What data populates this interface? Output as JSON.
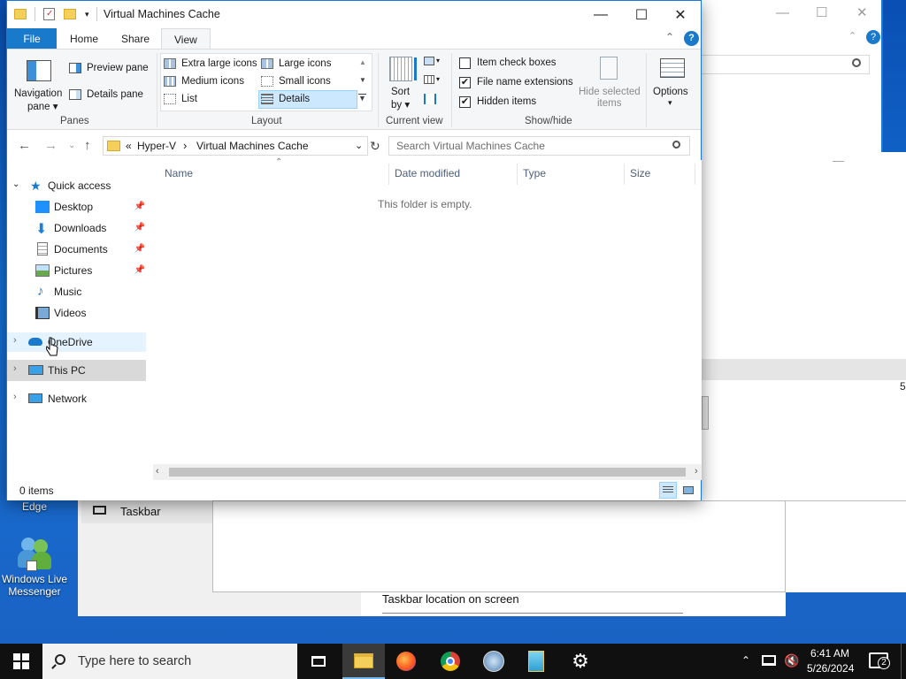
{
  "window": {
    "title": "Virtual Machines Cache",
    "minimize": "—",
    "maximize": "☐",
    "close": "✕"
  },
  "tabs": {
    "file": "File",
    "home": "Home",
    "share": "Share",
    "view": "View"
  },
  "ribbon": {
    "panes": {
      "navigation_pane_line1": "Navigation",
      "navigation_pane_line2": "pane ▾",
      "preview_pane": "Preview pane",
      "details_pane": "Details pane",
      "group_label": "Panes"
    },
    "layout": {
      "extra_large_icons": "Extra large icons",
      "large_icons": "Large icons",
      "medium_icons": "Medium icons",
      "small_icons": "Small icons",
      "list": "List",
      "details": "Details",
      "group_label": "Layout"
    },
    "current_view": {
      "sort_by_line1": "Sort",
      "sort_by_line2": "by ▾",
      "group_label": "Current view"
    },
    "show_hide": {
      "item_check_boxes": "Item check boxes",
      "item_check_boxes_checked": "",
      "file_name_extensions": "File name extensions",
      "file_name_extensions_checked": "✔",
      "hidden_items": "Hidden items",
      "hidden_items_checked": "✔",
      "hide_selected_line1": "Hide selected",
      "hide_selected_line2": "items",
      "group_label": "Show/hide"
    },
    "options_label": "Options",
    "options_arrow": "▾"
  },
  "address": {
    "breadcrumb_prefix": "«",
    "crumb1": "Hyper-V",
    "crumb_sep": "›",
    "crumb2": "Virtual Machines Cache",
    "search_placeholder": "Search Virtual Machines Cache"
  },
  "nav": {
    "quick_access": "Quick access",
    "desktop": "Desktop",
    "downloads": "Downloads",
    "documents": "Documents",
    "pictures": "Pictures",
    "music": "Music",
    "videos": "Videos",
    "onedrive": "OneDrive",
    "this_pc": "This PC",
    "network": "Network"
  },
  "columns": {
    "name": "Name",
    "date_modified": "Date modified",
    "type": "Type",
    "size": "Size"
  },
  "empty_message": "This folder is empty.",
  "status": {
    "item_count": "0 items"
  },
  "desktop_icons": {
    "edge": "Edge",
    "messenger_line1": "Windows Live",
    "messenger_line2": "Messenger"
  },
  "background": {
    "taskbar_item": "Taskbar",
    "taskbar_location": "Taskbar location on screen",
    "edge_digit": "5"
  },
  "taskbar": {
    "search_placeholder": "Type here to search",
    "time": "6:41 AM",
    "date": "5/26/2024",
    "notification_count": "2"
  }
}
